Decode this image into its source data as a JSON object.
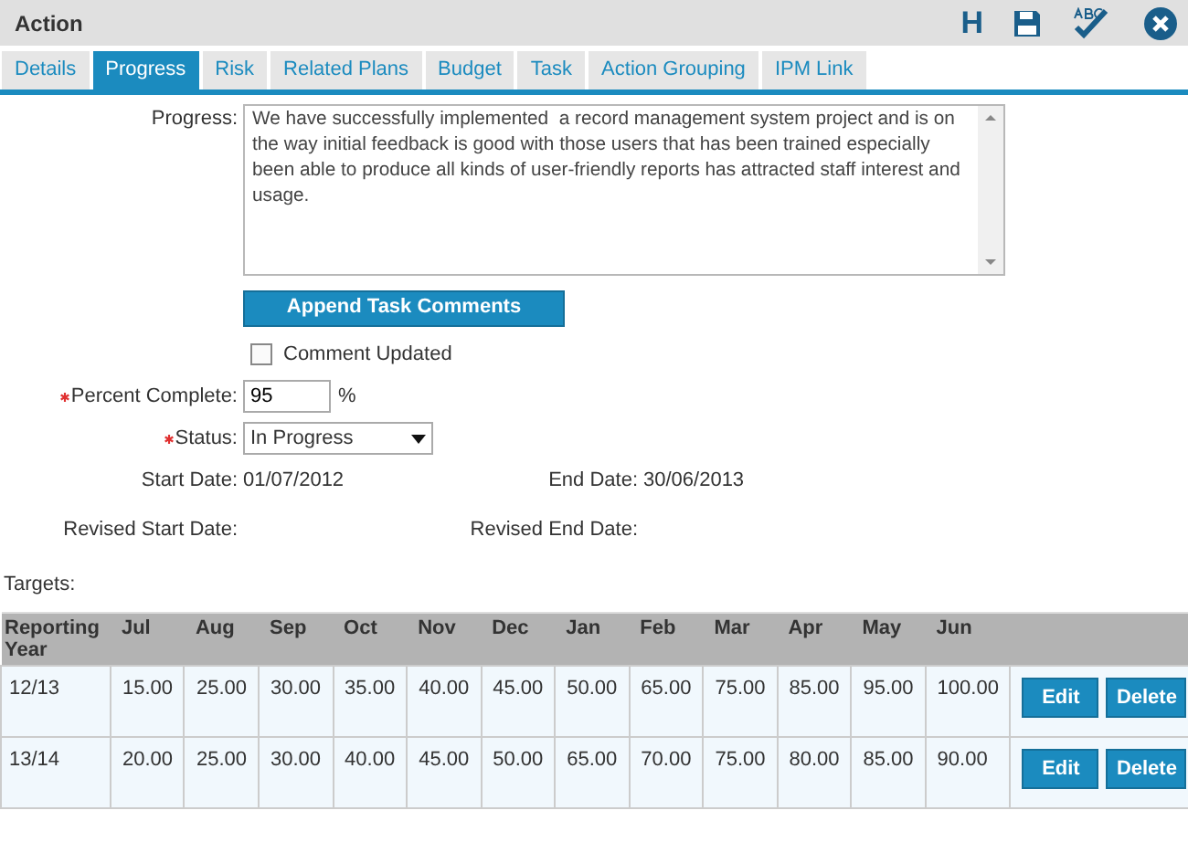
{
  "window": {
    "title": "Action"
  },
  "toolbar": [
    {
      "kind": "text",
      "label": "H"
    },
    {
      "kind": "save"
    },
    {
      "kind": "spellcheck"
    },
    {
      "kind": "close"
    }
  ],
  "tabs": [
    {
      "label": "Details",
      "selected": false
    },
    {
      "label": "Progress",
      "selected": true
    },
    {
      "label": "Risk",
      "selected": false
    },
    {
      "label": "Related Plans",
      "selected": false
    },
    {
      "label": "Budget",
      "selected": false
    },
    {
      "label": "Task",
      "selected": false
    },
    {
      "label": "Action Grouping",
      "selected": false
    },
    {
      "label": "IPM Link",
      "selected": false
    }
  ],
  "progress": {
    "label": "Progress:",
    "value": "We have successfully implemented  a record management system project and is on the way initial feedback is good with those users that has been trained especially been able to produce all kinds of user-friendly reports has attracted staff interest and usage."
  },
  "append_button": "Append Task Comments",
  "comment_updated": {
    "label": "Comment Updated",
    "checked": false
  },
  "percent_complete": {
    "label": "Percent Complete:",
    "required": true,
    "value": "95",
    "unit": "%"
  },
  "status": {
    "label": "Status:",
    "required": true,
    "value": "In Progress"
  },
  "dates": [
    {
      "label": "Start Date:",
      "value": "01/07/2012"
    },
    {
      "label": "End Date:",
      "value": "30/06/2013"
    },
    {
      "label": "Revised Start Date:"
    },
    {
      "label": "Revised End Date:"
    }
  ],
  "targets": {
    "label": "Targets:",
    "columns": [
      "Reporting Year",
      "Jul",
      "Aug",
      "Sep",
      "Oct",
      "Nov",
      "Dec",
      "Jan",
      "Feb",
      "Mar",
      "Apr",
      "May",
      "Jun"
    ],
    "rows": [
      {
        "cells": [
          "12/13",
          "15.00",
          "25.00",
          "30.00",
          "35.00",
          "40.00",
          "45.00",
          "50.00",
          "65.00",
          "75.00",
          "85.00",
          "95.00",
          "100.00"
        ],
        "actions": [
          "Edit",
          "Delete"
        ]
      },
      {
        "cells": [
          "13/14",
          "20.00",
          "25.00",
          "30.00",
          "40.00",
          "45.00",
          "50.00",
          "65.00",
          "70.00",
          "75.00",
          "80.00",
          "85.00",
          "90.00"
        ],
        "actions": [
          "Edit",
          "Delete"
        ]
      }
    ]
  }
}
